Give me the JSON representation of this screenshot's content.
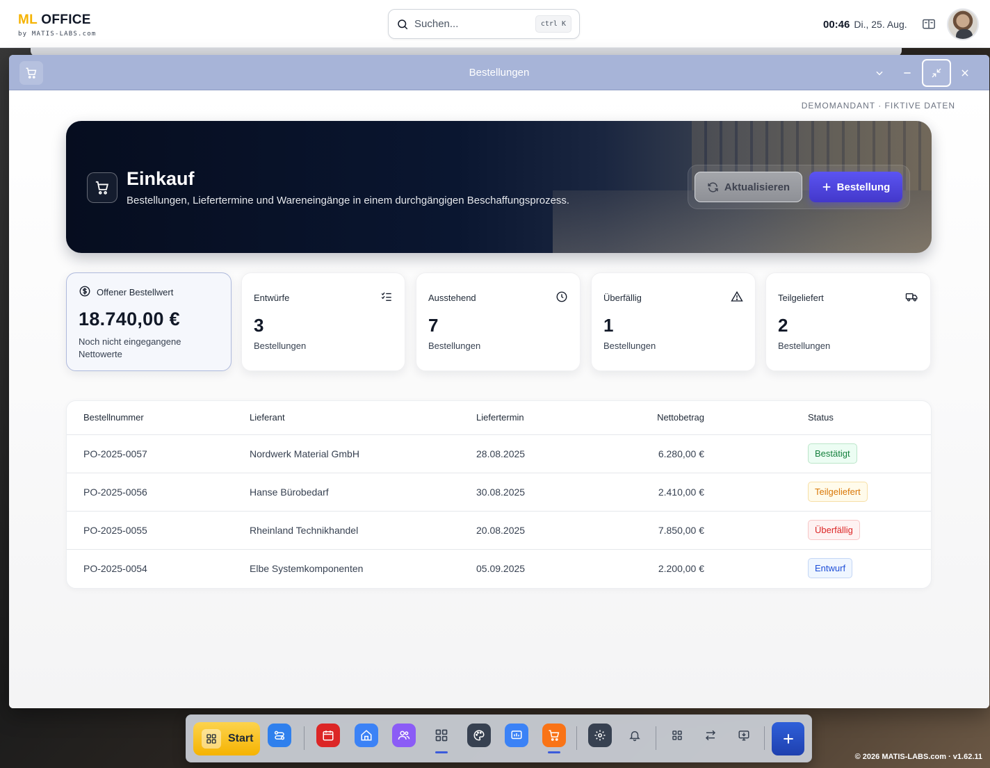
{
  "topbar": {
    "logo_ml": "ML",
    "logo_office": "OFFICE",
    "logo_sub": "by MATIS-LABS.com",
    "search_placeholder": "Suchen...",
    "search_shortcut": "ctrl K",
    "time": "00:46",
    "date": "Di., 25. Aug."
  },
  "window": {
    "title": "Bestellungen",
    "tenant_label": "DEMOMANDANT · FIKTIVE DATEN"
  },
  "hero": {
    "title": "Einkauf",
    "subtitle": "Bestellungen, Liefertermine und Wareneingänge in einem durchgängigen Beschaffungsprozess.",
    "refresh_label": "Aktualisieren",
    "new_label": "Bestellung"
  },
  "kpis": [
    {
      "label": "Offener Bestellwert",
      "value": "18.740,00 €",
      "desc": "Noch nicht eingegangene Nettowerte",
      "icon": "dollar-circle-icon"
    },
    {
      "label": "Entwürfe",
      "value": "3",
      "desc": "Bestellungen",
      "icon": "list-check-icon"
    },
    {
      "label": "Ausstehend",
      "value": "7",
      "desc": "Bestellungen",
      "icon": "clock-icon"
    },
    {
      "label": "Überfällig",
      "value": "1",
      "desc": "Bestellungen",
      "icon": "warning-icon"
    },
    {
      "label": "Teilgeliefert",
      "value": "2",
      "desc": "Bestellungen",
      "icon": "truck-icon"
    }
  ],
  "table": {
    "columns": [
      "Bestellnummer",
      "Lieferant",
      "Liefertermin",
      "Nettobetrag",
      "Status"
    ],
    "rows": [
      {
        "id": "PO-2025-0057",
        "supplier": "Nordwerk Material GmbH",
        "date": "28.08.2025",
        "amount": "6.280,00 €",
        "status": "Bestätigt"
      },
      {
        "id": "PO-2025-0056",
        "supplier": "Hanse Bürobedarf",
        "date": "30.08.2025",
        "amount": "2.410,00 €",
        "status": "Teilgeliefert"
      },
      {
        "id": "PO-2025-0055",
        "supplier": "Rheinland Technikhandel",
        "date": "20.08.2025",
        "amount": "7.850,00 €",
        "status": "Überfällig"
      },
      {
        "id": "PO-2025-0054",
        "supplier": "Elbe Systemkomponenten",
        "date": "05.09.2025",
        "amount": "2.200,00 €",
        "status": "Entwurf"
      }
    ]
  },
  "dock": {
    "start_label": "Start"
  },
  "footer": "© 2026 MATIS-LABS.com · v1.62.11",
  "colors": {
    "accent": "#4f46e5",
    "titlebar": "#a7b4d8",
    "brand_yellow": "#f5b301"
  }
}
